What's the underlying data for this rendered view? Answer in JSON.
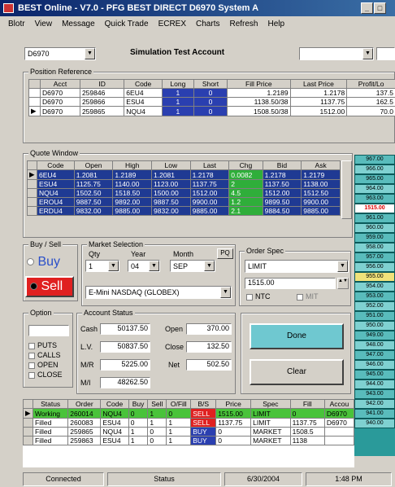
{
  "window": {
    "title": "BEST Online - V7.0 - PFG BEST DIRECT D6970 System A"
  },
  "menu": [
    "Blotr",
    "View",
    "Message",
    "Quick Trade",
    "ECREX",
    "Charts",
    "Refresh",
    "Help"
  ],
  "account_combo": "D6970",
  "account_title": "Simulation Test Account",
  "positions": {
    "label": "Position Reference",
    "headers": [
      "Acct",
      "ID",
      "Code",
      "Long",
      "Short",
      "Fill Price",
      "Last Price",
      "Profit/Lo"
    ],
    "rows": [
      [
        "D6970",
        "259846",
        "6EU4",
        "1",
        "0",
        "1.2189",
        "1.2178",
        "137.5"
      ],
      [
        "D6970",
        "259866",
        "ESU4",
        "1",
        "0",
        "1138.50/38",
        "1137.75",
        "162.5"
      ],
      [
        "D6970",
        "259865",
        "NQU4",
        "1",
        "0",
        "1508.50/38",
        "1512.00",
        "70.0"
      ]
    ]
  },
  "quote": {
    "label": "Quote Window",
    "headers": [
      "Code",
      "Open",
      "High",
      "Low",
      "Last",
      "Chg",
      "Bid",
      "Ask"
    ],
    "rows": [
      [
        "6EU4",
        "1.2081",
        "1.2189",
        "1.2081",
        "1.2178",
        "0.0082",
        "1.2178",
        "1.2179"
      ],
      [
        "ESU4",
        "1125.75",
        "1140.00",
        "1123.00",
        "1137.75",
        "2",
        "1137.50",
        "1138.00"
      ],
      [
        "NQU4",
        "1502.50",
        "1518.50",
        "1500.00",
        "1512.00",
        "4.5",
        "1512.00",
        "1512.50"
      ],
      [
        "EROU4",
        "9887.50",
        "9892.00",
        "9887.50",
        "9900.00",
        "1.2",
        "9899.50",
        "9900.00"
      ],
      [
        "ERDU4",
        "9832.00",
        "9885.00",
        "9832.00",
        "9885.00",
        "2.1",
        "9884.50",
        "9885.00"
      ]
    ]
  },
  "buysell": {
    "label": "Buy / Sell",
    "buy": "Buy",
    "sell": "Sell"
  },
  "market": {
    "label": "Market Selection",
    "qty_label": "Qty",
    "qty": "1",
    "year_label": "Year",
    "year": "04",
    "month_label": "Month",
    "month": "SEP",
    "pq": "PQ",
    "contract": "E-Mini NASDAQ (GLOBEX)"
  },
  "order_spec": {
    "label": "Order Spec",
    "type": "LIMIT",
    "price": "1515.00",
    "ntc": "NTC",
    "mit": "MIT"
  },
  "option": {
    "label": "Option",
    "items": [
      "PUTS",
      "CALLS",
      "OPEN",
      "CLOSE"
    ]
  },
  "account_status": {
    "label": "Account Status",
    "cash_label": "Cash",
    "cash": "50137.50",
    "lv_label": "L.V.",
    "lv": "50837.50",
    "mr_label": "M/R",
    "mr": "5225.00",
    "ml_label": "M/I",
    "ml": "48262.50",
    "open_label": "Open",
    "open": "370.00",
    "close_label": "Close",
    "close": "132.50",
    "net_label": "Net",
    "net": "502.50"
  },
  "buttons": {
    "done": "Done",
    "clear": "Clear"
  },
  "orders": {
    "headers": [
      "Status",
      "Order",
      "Code",
      "Buy",
      "Sell",
      "O/Fill",
      "B/S",
      "Price",
      "Spec",
      "Fill",
      "Accou"
    ],
    "rows": [
      [
        "Working",
        "260014",
        "NQU4",
        "0",
        "1",
        "0",
        "SELL",
        "1515.00",
        "LIMIT",
        "0",
        "D6970"
      ],
      [
        "Filled",
        "260083",
        "ESU4",
        "0",
        "1",
        "1",
        "SELL",
        "1137.75",
        "LIMIT",
        "1137.75",
        "D6970"
      ],
      [
        "Filled",
        "259865",
        "NQU4",
        "1",
        "0",
        "1",
        "BUY",
        "0",
        "MARKET",
        "1508.5",
        ""
      ],
      [
        "Filled",
        "259863",
        "ESU4",
        "1",
        "0",
        "1",
        "BUY",
        "0",
        "MARKET",
        "1138",
        ""
      ]
    ]
  },
  "side_ladder": [
    "967.00",
    "966.00",
    "965.00",
    "964.00",
    "963.00",
    "1515.00",
    "961.00",
    "960.00",
    "959.00",
    "958.00",
    "957.00",
    "956.00",
    "955.00",
    "954.00",
    "953.00",
    "952.00",
    "951.00",
    "950.00",
    "949.00",
    "948.00",
    "947.00",
    "946.00",
    "945.00",
    "944.00",
    "943.00",
    "942.00",
    "941.00",
    "940.00"
  ],
  "status_bar": {
    "connection": "Connected",
    "status": "Status",
    "date": "6/30/2004",
    "time": "1:48 PM"
  },
  "colors": {
    "accent_blue": "#1f3a93",
    "sell_red": "#e02020",
    "done_teal": "#6fc8d0",
    "green_row": "#49c33a"
  }
}
